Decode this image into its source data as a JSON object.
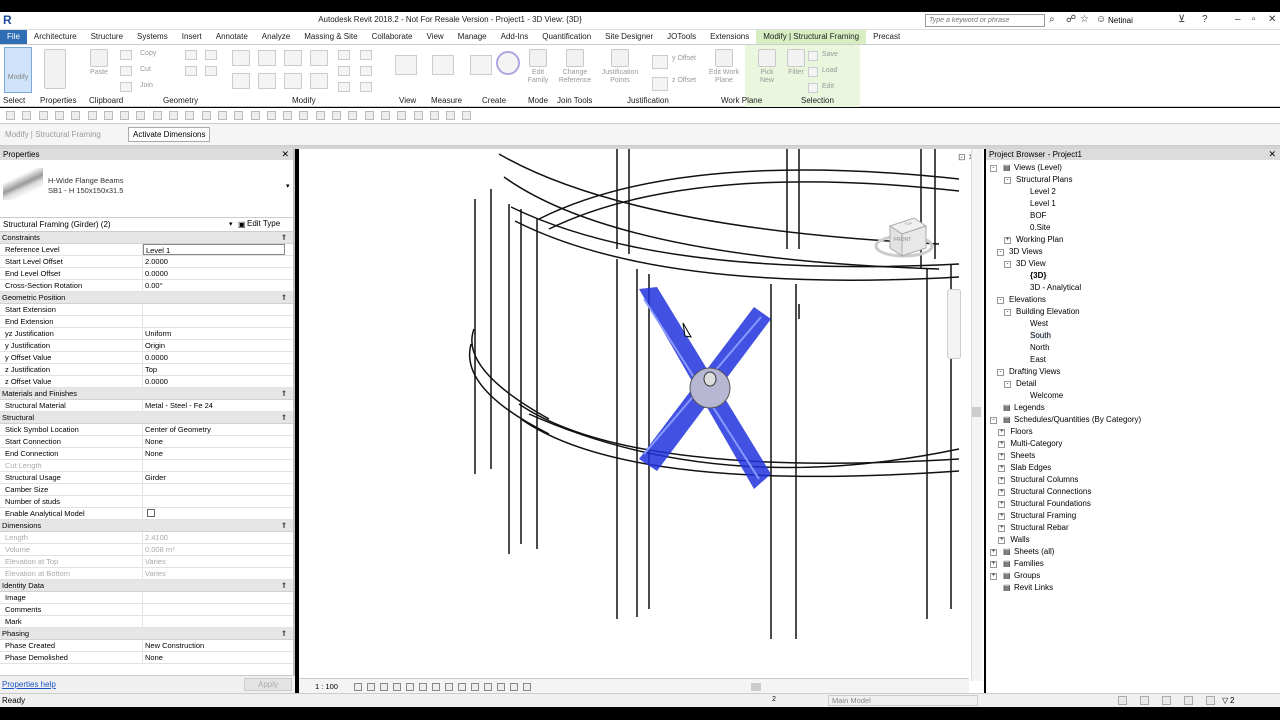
{
  "app": {
    "title": "Autodesk Revit 2018.2 - Not For Resale Version -   Project1 - 3D View: {3D}",
    "logo": "R",
    "search_placeholder": "Type a keyword or phrase",
    "user": "Netinai"
  },
  "menu": {
    "tabs": [
      "File",
      "Architecture",
      "Structure",
      "Systems",
      "Insert",
      "Annotate",
      "Analyze",
      "Massing & Site",
      "Collaborate",
      "View",
      "Manage",
      "Add-Ins",
      "Quantification",
      "Site Designer",
      "JOTools",
      "Extensions",
      "Modify | Structural Framing",
      "Precast"
    ]
  },
  "ribbon": {
    "buttons": {
      "modify": "Modify",
      "paste": "Paste",
      "copy": "Copy",
      "cut": "Cut",
      "join": "Join",
      "edit_family": "Edit Family",
      "change_reference": "Change Reference",
      "justification_points": "Justification Points",
      "y_offset": "y Offset",
      "z_offset": "z Offset",
      "edit_work_plane": "Edit Work Plane",
      "pick_new": "Pick New",
      "filter": "Filter",
      "save": "Save",
      "load": "Load",
      "edit": "Edit"
    },
    "groups": [
      "Select",
      "Properties",
      "Clipboard",
      "Geometry",
      "Modify",
      "View",
      "Measure",
      "Create",
      "Mode",
      "Join Tools",
      "Justification",
      "Work Plane",
      "Selection"
    ]
  },
  "options_bar": {
    "label": "Modify | Structural Framing",
    "activate_dimensions": "Activate Dimensions"
  },
  "properties": {
    "title": "Properties",
    "family": "H-Wide Flange Beams",
    "type": "SB1 - H 150x150x31.5",
    "category": "Structural Framing (Girder) (2)",
    "edit_type": "Edit Type",
    "sections": [
      {
        "name": "Constraints",
        "rows": [
          {
            "k": "Reference Level",
            "v": "Level 1"
          },
          {
            "k": "Start Level Offset",
            "v": "2.0000"
          },
          {
            "k": "End Level Offset",
            "v": "0.0000"
          },
          {
            "k": "Cross-Section Rotation",
            "v": "0.00°"
          }
        ]
      },
      {
        "name": "Geometric Position",
        "rows": [
          {
            "k": "Start Extension",
            "v": ""
          },
          {
            "k": "End Extension",
            "v": ""
          },
          {
            "k": "yz Justification",
            "v": "Uniform"
          },
          {
            "k": "y Justification",
            "v": "Origin"
          },
          {
            "k": "y Offset Value",
            "v": "0.0000"
          },
          {
            "k": "z Justification",
            "v": "Top"
          },
          {
            "k": "z Offset Value",
            "v": "0.0000"
          }
        ]
      },
      {
        "name": "Materials and Finishes",
        "rows": [
          {
            "k": "Structural Material",
            "v": "Metal - Steel - Fe 24"
          }
        ]
      },
      {
        "name": "Structural",
        "rows": [
          {
            "k": "Stick Symbol Location",
            "v": "Center of Geometry"
          },
          {
            "k": "Start Connection",
            "v": "None"
          },
          {
            "k": "End Connection",
            "v": "None"
          },
          {
            "k": "Cut Length",
            "v": "",
            "dis": true
          },
          {
            "k": "Structural Usage",
            "v": "Girder"
          },
          {
            "k": "Camber Size",
            "v": ""
          },
          {
            "k": "Number of studs",
            "v": ""
          },
          {
            "k": "Enable Analytical Model",
            "v": "",
            "checkbox": true
          }
        ]
      },
      {
        "name": "Dimensions",
        "rows": [
          {
            "k": "Length",
            "v": "2.4100",
            "dis": true
          },
          {
            "k": "Volume",
            "v": "0.008 m³",
            "dis": true
          },
          {
            "k": "Elevation at Top",
            "v": "Varies",
            "dis": true
          },
          {
            "k": "Elevation at Bottom",
            "v": "Varies",
            "dis": true
          }
        ]
      },
      {
        "name": "Identity Data",
        "rows": [
          {
            "k": "Image",
            "v": ""
          },
          {
            "k": "Comments",
            "v": ""
          },
          {
            "k": "Mark",
            "v": ""
          }
        ]
      },
      {
        "name": "Phasing",
        "rows": [
          {
            "k": "Phase Created",
            "v": "New Construction"
          },
          {
            "k": "Phase Demolished",
            "v": "None"
          }
        ]
      }
    ],
    "help": "Properties help",
    "apply": "Apply"
  },
  "view": {
    "scale": "1 : 100",
    "cube_face": "FRONT",
    "cube_top": "TOP"
  },
  "browser": {
    "title": "Project Browser - Project1",
    "nodes": [
      {
        "t": "Views (Level)",
        "d": 0,
        "e": "-"
      },
      {
        "t": "Structural Plans",
        "d": 1,
        "e": "-"
      },
      {
        "t": "Level 2",
        "d": 2
      },
      {
        "t": "Level 1",
        "d": 2
      },
      {
        "t": "BOF",
        "d": 2
      },
      {
        "t": "0.Site",
        "d": 2
      },
      {
        "t": "Working Plan",
        "d": 1,
        "e": "+"
      },
      {
        "t": "3D Views",
        "d": 0.5,
        "e": "-"
      },
      {
        "t": "3D View",
        "d": 1,
        "e": "-"
      },
      {
        "t": "{3D}",
        "d": 2,
        "b": true
      },
      {
        "t": "3D - Analytical",
        "d": 2
      },
      {
        "t": "Elevations",
        "d": 0.5,
        "e": "-"
      },
      {
        "t": "Building Elevation",
        "d": 1,
        "e": "-"
      },
      {
        "t": "West",
        "d": 2
      },
      {
        "t": "South",
        "d": 2,
        "sel": true
      },
      {
        "t": "North",
        "d": 2
      },
      {
        "t": "East",
        "d": 2
      },
      {
        "t": "Drafting Views",
        "d": 0.5,
        "e": "-"
      },
      {
        "t": "Detail",
        "d": 1,
        "e": "-"
      },
      {
        "t": "Welcome",
        "d": 2
      },
      {
        "t": "Legends",
        "d": 0
      },
      {
        "t": "Schedules/Quantities (By Category)",
        "d": 0,
        "e": "-"
      },
      {
        "t": "Floors",
        "d": 0.6,
        "e": "+"
      },
      {
        "t": "Multi-Category",
        "d": 0.6,
        "e": "+"
      },
      {
        "t": "Sheets",
        "d": 0.6,
        "e": "+"
      },
      {
        "t": "Slab Edges",
        "d": 0.6,
        "e": "+"
      },
      {
        "t": "Structural Columns",
        "d": 0.6,
        "e": "+"
      },
      {
        "t": "Structural Connections",
        "d": 0.6,
        "e": "+"
      },
      {
        "t": "Structural Foundations",
        "d": 0.6,
        "e": "+"
      },
      {
        "t": "Structural Framing",
        "d": 0.6,
        "e": "+"
      },
      {
        "t": "Structural Rebar",
        "d": 0.6,
        "e": "+"
      },
      {
        "t": "Walls",
        "d": 0.6,
        "e": "+"
      },
      {
        "t": "Sheets (all)",
        "d": 0,
        "e": "+"
      },
      {
        "t": "Families",
        "d": 0,
        "e": "+"
      },
      {
        "t": "Groups",
        "d": 0,
        "e": "+"
      },
      {
        "t": "Revit Links",
        "d": 0
      }
    ]
  },
  "status": {
    "text": "Ready",
    "model": "Main Model",
    "count": "2"
  },
  "colors": {
    "selected": "#2233dd",
    "file_tab": "#2f6db5",
    "context_tab": "#d7eec2"
  }
}
